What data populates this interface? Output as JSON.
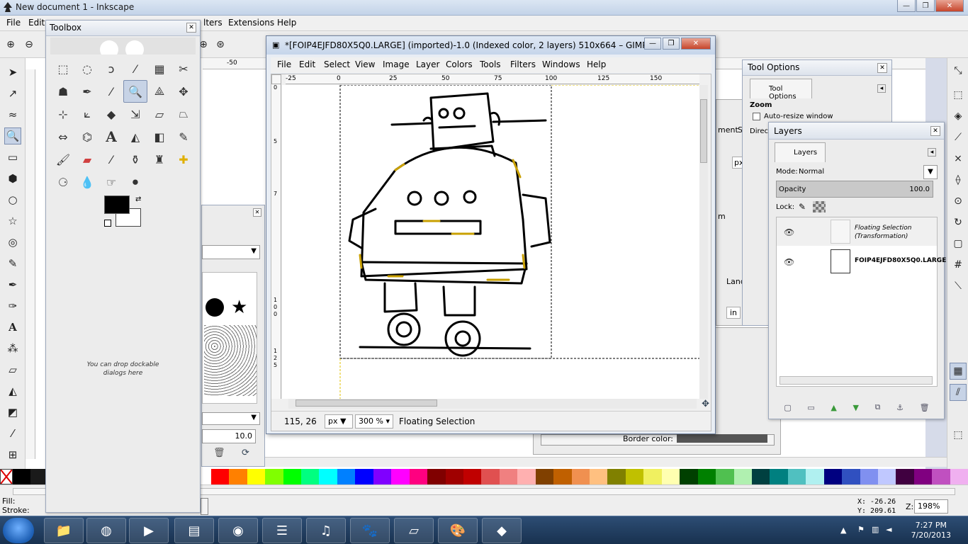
{
  "inkscape": {
    "title": "New document 1 - Inkscape",
    "menu": [
      "File",
      "Edit",
      "lters",
      "Extensions",
      "Help"
    ],
    "ruler_label": "-50",
    "status": {
      "fill": "Fill:",
      "stroke": "Stroke:",
      "x": "X:  -26.26",
      "y": "Y:  209.61",
      "z": "Z:",
      "zoom": "198%"
    },
    "behind_panel": {
      "ment": "ment",
      "s": "S",
      "px": "px",
      "m": "m",
      "land": "Land",
      "in": "in",
      "border_color": "Border color:"
    }
  },
  "toolbox": {
    "title": "Toolbox",
    "drop_hint_line1": "You can drop dockable",
    "drop_hint_line2": "dialogs here",
    "brush_size": "10.0"
  },
  "gimp": {
    "title": "*[FOIP4EJFD80X5Q0.LARGE] (imported)-1.0 (Indexed color, 2 layers) 510x664 – GIMP",
    "menu": [
      "File",
      "Edit",
      "Select",
      "View",
      "Image",
      "Layer",
      "Colors",
      "Tools",
      "Filters",
      "Windows",
      "Help"
    ],
    "ruler_h": [
      "-25",
      "0",
      "25",
      "50",
      "75",
      "100",
      "125",
      "150"
    ],
    "ruler_v": [
      "0",
      "5",
      "7",
      "1",
      "0",
      "0",
      "1",
      "2",
      "5"
    ],
    "status": {
      "coords": "115, 26",
      "unit": "px",
      "zoom": "300 %",
      "message": "Floating Selection"
    }
  },
  "tool_options": {
    "title": "Tool Options",
    "tab_label": "Tool Options",
    "section": "Zoom",
    "auto_resize": "Auto-resize window",
    "direction": "Direct"
  },
  "layers": {
    "title": "Layers",
    "tab_label": "Layers",
    "mode_label": "Mode:",
    "mode_value": "Normal",
    "opacity_label": "Opacity",
    "opacity_value": "100.0",
    "lock_label": "Lock:",
    "items": [
      {
        "name_line1": "Floating Selection",
        "name_line2": "(Transformation)"
      },
      {
        "name_line1": "FOIP4EJFD80X5Q0.LARGE",
        "name_line2": ""
      }
    ]
  },
  "taskbar": {
    "time": "7:27 PM",
    "date": "7/20/2013"
  }
}
